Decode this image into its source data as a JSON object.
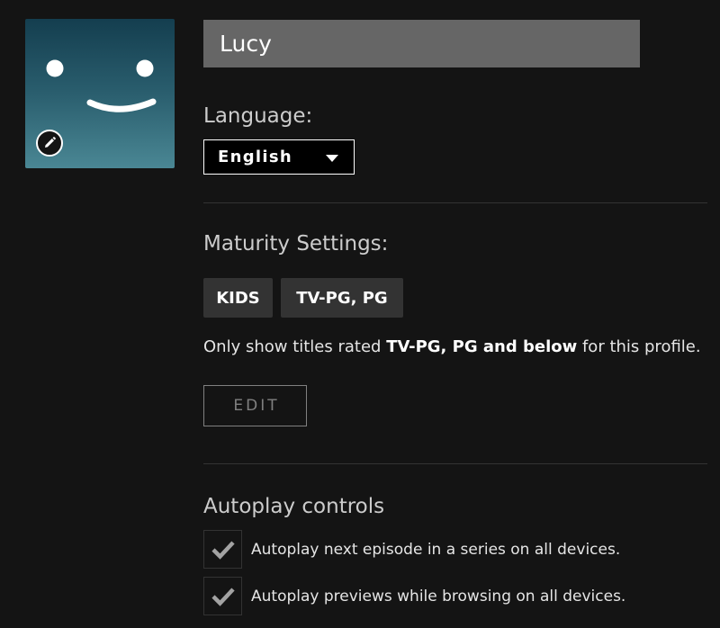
{
  "profile": {
    "avatar_icon": "smiley-face-icon",
    "avatar_colors": {
      "top": "#143e4f",
      "bottom": "#4a8794"
    },
    "edit_icon": "pencil-icon",
    "name_value": "Lucy"
  },
  "language": {
    "label": "Language:",
    "selected": "English",
    "caret_icon": "caret-down-icon"
  },
  "maturity": {
    "label": "Maturity Settings:",
    "badges": [
      "KIDS",
      "TV-PG, PG"
    ],
    "desc_prefix": "Only show titles rated ",
    "desc_bold": "TV-PG, PG and below",
    "desc_suffix": " for this profile.",
    "edit_label": "EDIT"
  },
  "autoplay": {
    "label": "Autoplay controls",
    "options": [
      {
        "label": "Autoplay next episode in a series on all devices.",
        "checked": true
      },
      {
        "label": "Autoplay previews while browsing on all devices.",
        "checked": true
      }
    ],
    "check_icon": "checkmark-icon"
  },
  "colors": {
    "background": "#141414",
    "input_bg": "#666666",
    "badge_bg": "#333333",
    "divider": "#333333",
    "muted": "#808080"
  }
}
